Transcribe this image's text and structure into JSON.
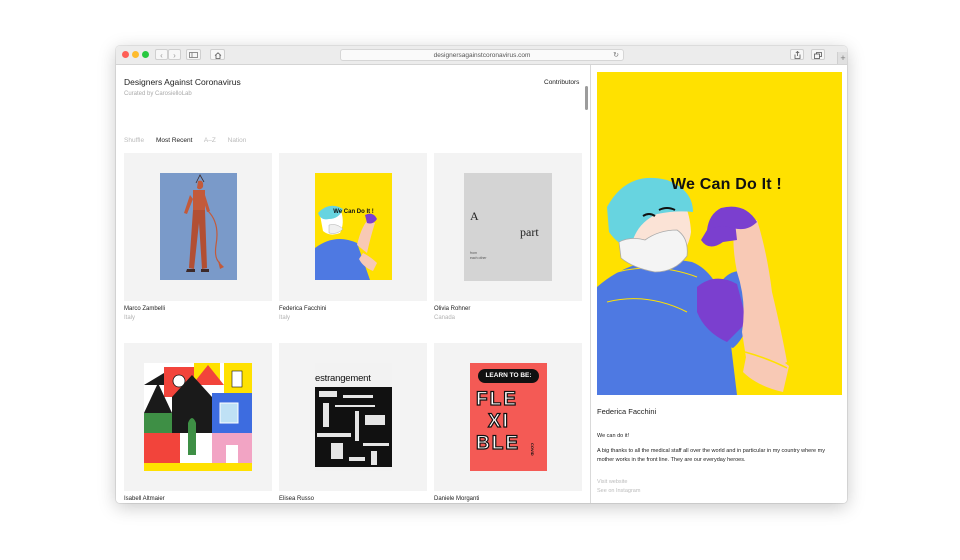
{
  "browser": {
    "url": "designersagainstcoronavirus.com",
    "traffic_colors": [
      "#fe5f57",
      "#febc2e",
      "#28c840"
    ]
  },
  "site": {
    "title": "Designers Against Coronavirus",
    "subtitle": "Curated by CarosielloLab",
    "contributors_label": "Contributors",
    "filters": [
      "Shuffle",
      "Most Recent",
      "A–Z",
      "Nation"
    ],
    "active_filter": "Most Recent"
  },
  "grid": [
    {
      "name": "Marco Zambelli",
      "nation": "Italy"
    },
    {
      "name": "Federica Facchini",
      "nation": "Italy",
      "poster_text": "We Can Do It !"
    },
    {
      "name": "Olivia Rohner",
      "nation": "Canada",
      "poster_words": [
        "A",
        "part"
      ],
      "poster_small": [
        "from",
        "each other"
      ]
    },
    {
      "name": "Isabell Altmaier",
      "nation": ""
    },
    {
      "name": "Elisea Russo",
      "nation": "",
      "poster_text": "estrangement"
    },
    {
      "name": "Daniele Morganti",
      "nation": "",
      "poster_header": "LEARN TO BE:",
      "poster_letters": [
        "FLE",
        "XI",
        "BLE"
      ],
      "poster_side": "COVID"
    }
  ],
  "detail": {
    "poster_text": "We Can Do It !",
    "name": "Federica Facchini",
    "title": "We can do it!",
    "description": "A big thanks to all the medical staff all over the world and in particular in my country where my mother works in the front line. They are our everyday heroes.",
    "links": [
      "Visit website",
      "See on Instagram"
    ]
  },
  "colors": {
    "poster_yellow": "#ffe100",
    "poster_blue": "#7a9ac9",
    "poster_gray": "#d4d4d4",
    "poster_red": "#f45a55",
    "card_bg": "#f3f3f3"
  }
}
